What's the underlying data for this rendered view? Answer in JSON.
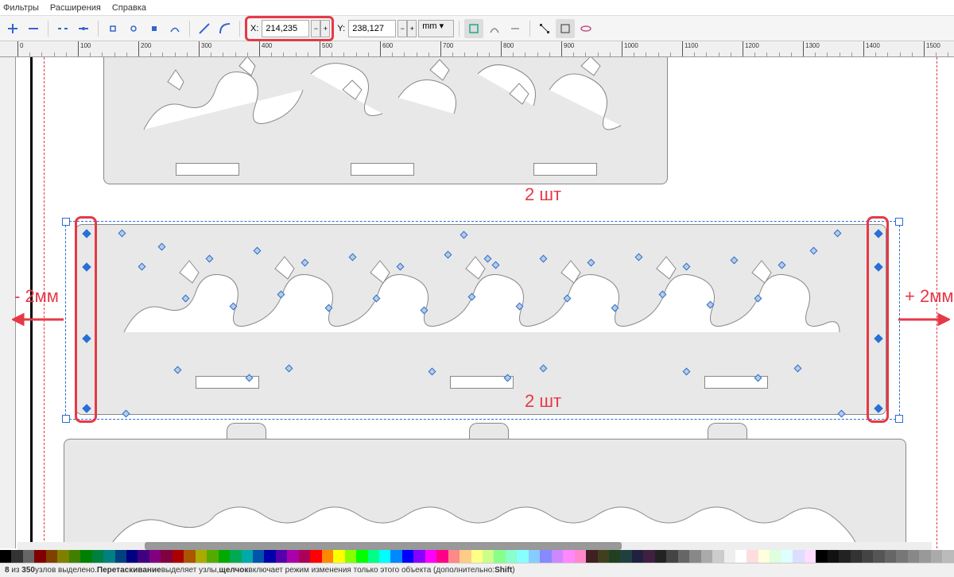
{
  "menu": {
    "filters": "Фильтры",
    "extensions": "Расширения",
    "help": "Справка"
  },
  "toolbar": {
    "x_label": "X:",
    "x_value": "214,235",
    "y_label": "Y:",
    "y_value": "238,127",
    "unit": "mm"
  },
  "ruler_ticks": [
    0,
    100,
    200,
    300,
    400,
    500,
    600,
    700,
    800,
    900,
    1000,
    1100,
    1200,
    1300,
    1400,
    1500
  ],
  "annotations": {
    "qty_top": "2 шт",
    "qty_mid": "2 шт",
    "left_label": "- 2мм",
    "right_label": "+ 2мм"
  },
  "status": {
    "selected": "8",
    "total": "350",
    "txt1": " узлов выделено. ",
    "txt2": "Перетаскивание",
    "txt3": " выделяет узлы, ",
    "txt4": "щелчок",
    "txt5": " включает режим изменения только этого объекта (дополнительно: ",
    "txt6": "Shift",
    "txt7": ")"
  },
  "palette": [
    "#000",
    "#333",
    "#666",
    "#800000",
    "#804000",
    "#808000",
    "#408000",
    "#008000",
    "#008040",
    "#008080",
    "#004080",
    "#000080",
    "#400080",
    "#800080",
    "#800040",
    "#a00",
    "#a50",
    "#aa0",
    "#5a0",
    "#0a0",
    "#0a5",
    "#0aa",
    "#05a",
    "#00a",
    "#50a",
    "#a0a",
    "#a05",
    "#f00",
    "#f80",
    "#ff0",
    "#8f0",
    "#0f0",
    "#0f8",
    "#0ff",
    "#08f",
    "#00f",
    "#80f",
    "#f0f",
    "#f08",
    "#f88",
    "#fc8",
    "#ff8",
    "#cf8",
    "#8f8",
    "#8fc",
    "#8ff",
    "#8cf",
    "#88f",
    "#c8f",
    "#f8f",
    "#f8c",
    "#402020",
    "#404020",
    "#204020",
    "#204040",
    "#202040",
    "#402040",
    "#222",
    "#444",
    "#666",
    "#888",
    "#aaa",
    "#ccc",
    "#eee",
    "#fff",
    "#fdd",
    "#ffd",
    "#dfd",
    "#dff",
    "#ddf",
    "#fdf",
    "#000",
    "#111",
    "#222",
    "#333",
    "#444",
    "#555",
    "#666",
    "#777",
    "#888",
    "#999",
    "#aaa",
    "#bbb"
  ]
}
